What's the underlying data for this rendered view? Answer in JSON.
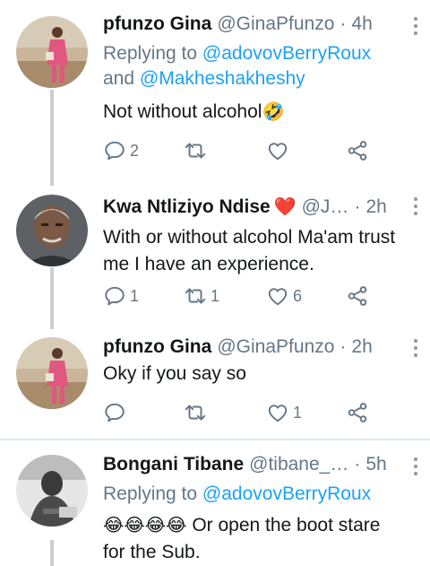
{
  "tweets": [
    {
      "name": "pfunzo Gina",
      "handle": "@GinaPfunzo",
      "time": "4h",
      "replying_prefix": "Replying to",
      "mention_1": "@adovovBerryRoux",
      "and_word": "and",
      "mention_2": "@Makheshakheshy",
      "text": "Not without alcohol",
      "emoji": "🤣",
      "replies": "2",
      "retweets": "",
      "likes": ""
    },
    {
      "name": "Kwa Ntliziyo Ndise",
      "name_emoji": "❤️",
      "handle": "@J…",
      "time": "2h",
      "text_line1": "With or without alcohol Ma'am trust",
      "text_line2": "me I have an experience.",
      "replies": "1",
      "retweets": "1",
      "likes": "6"
    },
    {
      "name": "pfunzo Gina",
      "handle": "@GinaPfunzo",
      "time": "2h",
      "text": "Oky if you say so",
      "replies": "",
      "retweets": "",
      "likes": "1"
    },
    {
      "name": "Bongani Tibane",
      "handle": "@tibane_…",
      "time": "5h",
      "replying_prefix": "Replying to",
      "mention_1": "@adovovBerryRoux",
      "emoji": "😂😂😂😂",
      "text_line1": " Or open the boot stare",
      "text_line2": "for the Sub."
    }
  ],
  "icons": [
    "reply-icon",
    "retweet-icon",
    "like-icon",
    "share-icon",
    "more-icon"
  ],
  "colors": {
    "link": "#1da1f2",
    "secondary_text": "#657786",
    "heart": "#d72545",
    "thread_line": "#c8d0d6"
  }
}
